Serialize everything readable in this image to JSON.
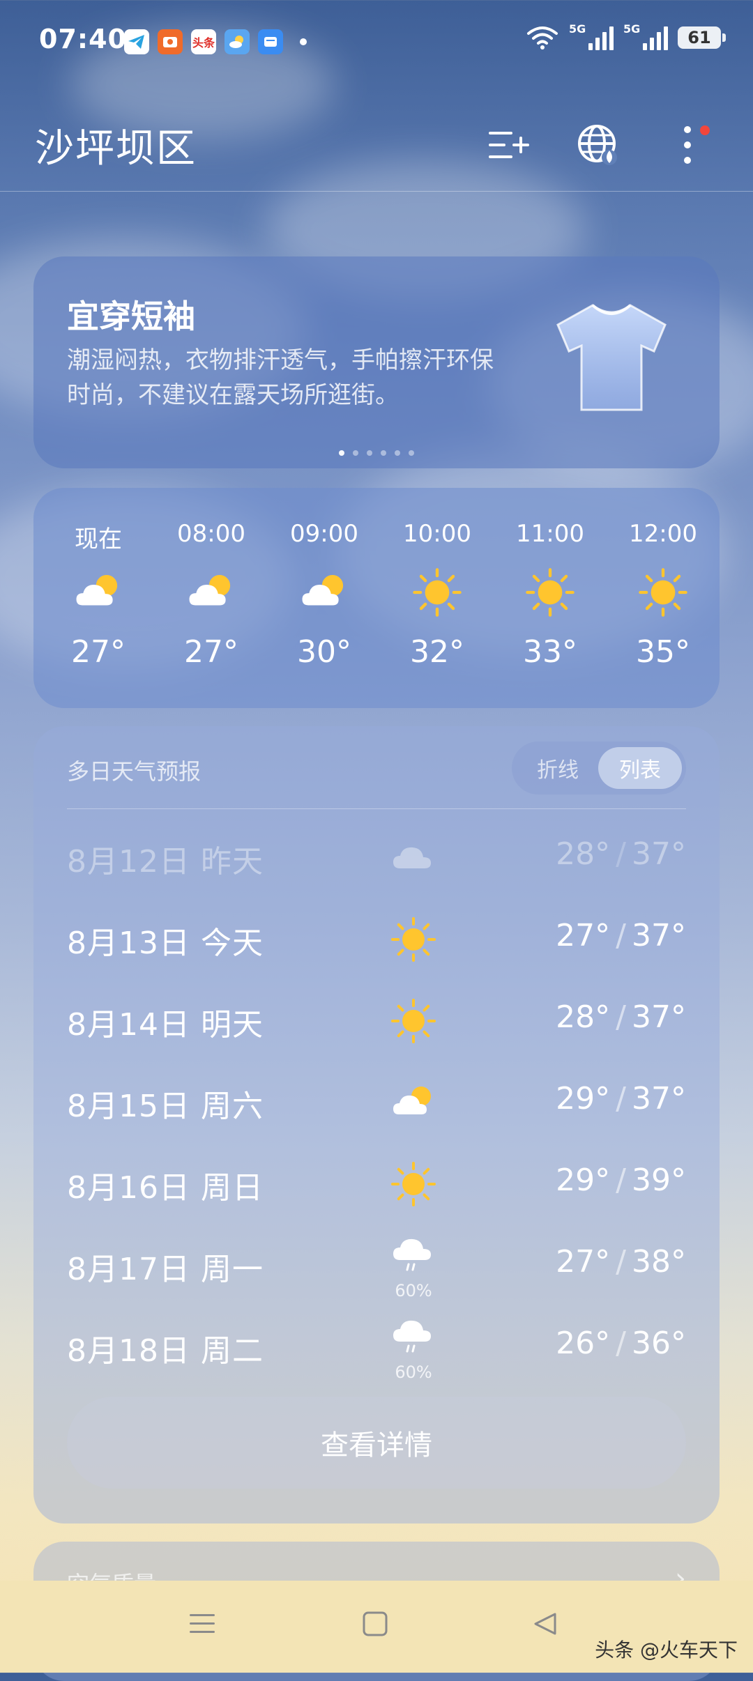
{
  "status_bar": {
    "time": "07:40",
    "apps": [
      "telegram-icon",
      "wallet-icon",
      "toutiao-icon",
      "weather-app-icon",
      "messages-icon"
    ],
    "toutiao_label": "头条",
    "net1": "5G",
    "net2": "5G",
    "battery": "61"
  },
  "header": {
    "city": "沙坪坝区"
  },
  "dress_card": {
    "title": "宜穿短袖",
    "desc": "潮湿闷热，衣物排汗透气，手帕擦汗环保时尚，不建议在露天场所逛街。",
    "pages": 6,
    "active_page": 0
  },
  "hourly": [
    {
      "time": "现在",
      "icon": "partly-cloudy-icon",
      "temp": "27°"
    },
    {
      "time": "08:00",
      "icon": "partly-cloudy-icon",
      "temp": "27°"
    },
    {
      "time": "09:00",
      "icon": "partly-cloudy-icon",
      "temp": "30°"
    },
    {
      "time": "10:00",
      "icon": "sun-icon",
      "temp": "32°"
    },
    {
      "time": "11:00",
      "icon": "sun-icon",
      "temp": "33°"
    },
    {
      "time": "12:00",
      "icon": "sun-icon",
      "temp": "35°"
    }
  ],
  "daily": {
    "title": "多日天气预报",
    "toggle_line": "折线",
    "toggle_list": "列表",
    "rows": [
      {
        "date": "8月12日  昨天",
        "icon": "cloud-icon",
        "pct": "",
        "low": "28°",
        "high": "37°"
      },
      {
        "date": "8月13日  今天",
        "icon": "sun-icon",
        "pct": "",
        "low": "27°",
        "high": "37°"
      },
      {
        "date": "8月14日  明天",
        "icon": "sun-icon",
        "pct": "",
        "low": "28°",
        "high": "37°"
      },
      {
        "date": "8月15日  周六",
        "icon": "partly-cloudy-icon",
        "pct": "",
        "low": "29°",
        "high": "37°"
      },
      {
        "date": "8月16日  周日",
        "icon": "sun-icon",
        "pct": "",
        "low": "29°",
        "high": "39°"
      },
      {
        "date": "8月17日  周一",
        "icon": "rain-icon",
        "pct": "60%",
        "low": "27°",
        "high": "38°"
      },
      {
        "date": "8月18日  周二",
        "icon": "rain-icon",
        "pct": "60%",
        "low": "26°",
        "high": "36°"
      }
    ],
    "separator": "/",
    "details_button": "查看详情"
  },
  "air_card": {
    "title": "空气质量",
    "chevron": "›"
  },
  "watermark": "头条 @火车天下",
  "colors": {
    "sun": "#FFC52E",
    "badge": "#F2463C"
  }
}
